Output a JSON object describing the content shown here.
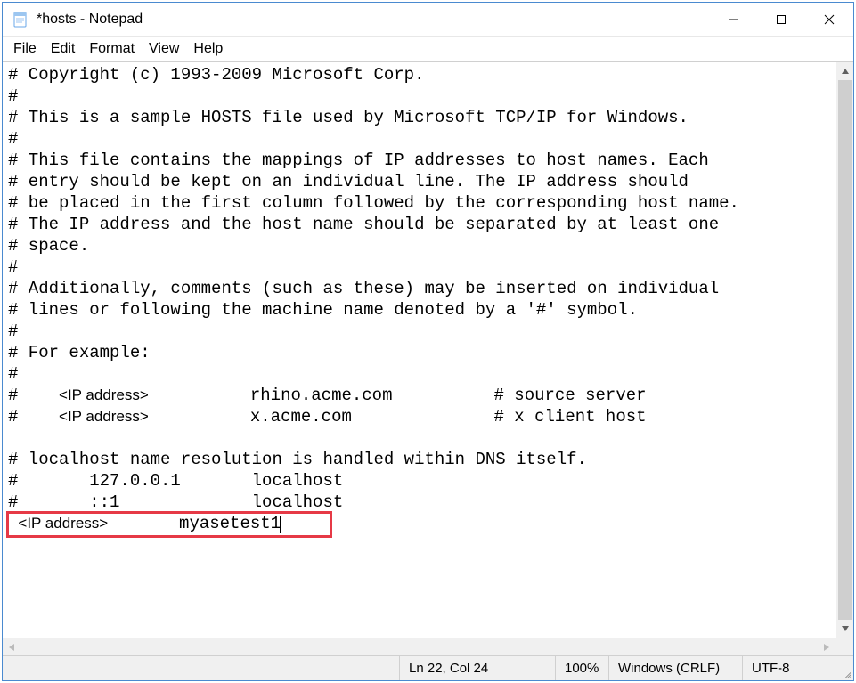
{
  "titlebar": {
    "title": "*hosts - Notepad"
  },
  "menubar": {
    "items": [
      "File",
      "Edit",
      "Format",
      "View",
      "Help"
    ]
  },
  "editor": {
    "lines": [
      "# Copyright (c) 1993-2009 Microsoft Corp.",
      "#",
      "# This is a sample HOSTS file used by Microsoft TCP/IP for Windows.",
      "#",
      "# This file contains the mappings of IP addresses to host names. Each",
      "# entry should be kept on an individual line. The IP address should",
      "# be placed in the first column followed by the corresponding host name.",
      "# The IP address and the host name should be separated by at least one",
      "# space.",
      "#",
      "# Additionally, comments (such as these) may be inserted on individual",
      "# lines or following the machine name denoted by a '#' symbol.",
      "#",
      "# For example:",
      "#",
      "#    <IP address>          rhino.acme.com          # source server",
      "#    <IP address>          x.acme.com              # x client host",
      "",
      "# localhost name resolution is handled within DNS itself.",
      "#       127.0.0.1       localhost",
      "#       ::1             localhost",
      " <IP address>       myasetest1"
    ],
    "ip_placeholder": "<IP address>"
  },
  "statusbar": {
    "position": "Ln 22, Col 24",
    "zoom": "100%",
    "line_endings": "Windows (CRLF)",
    "encoding": "UTF-8"
  }
}
